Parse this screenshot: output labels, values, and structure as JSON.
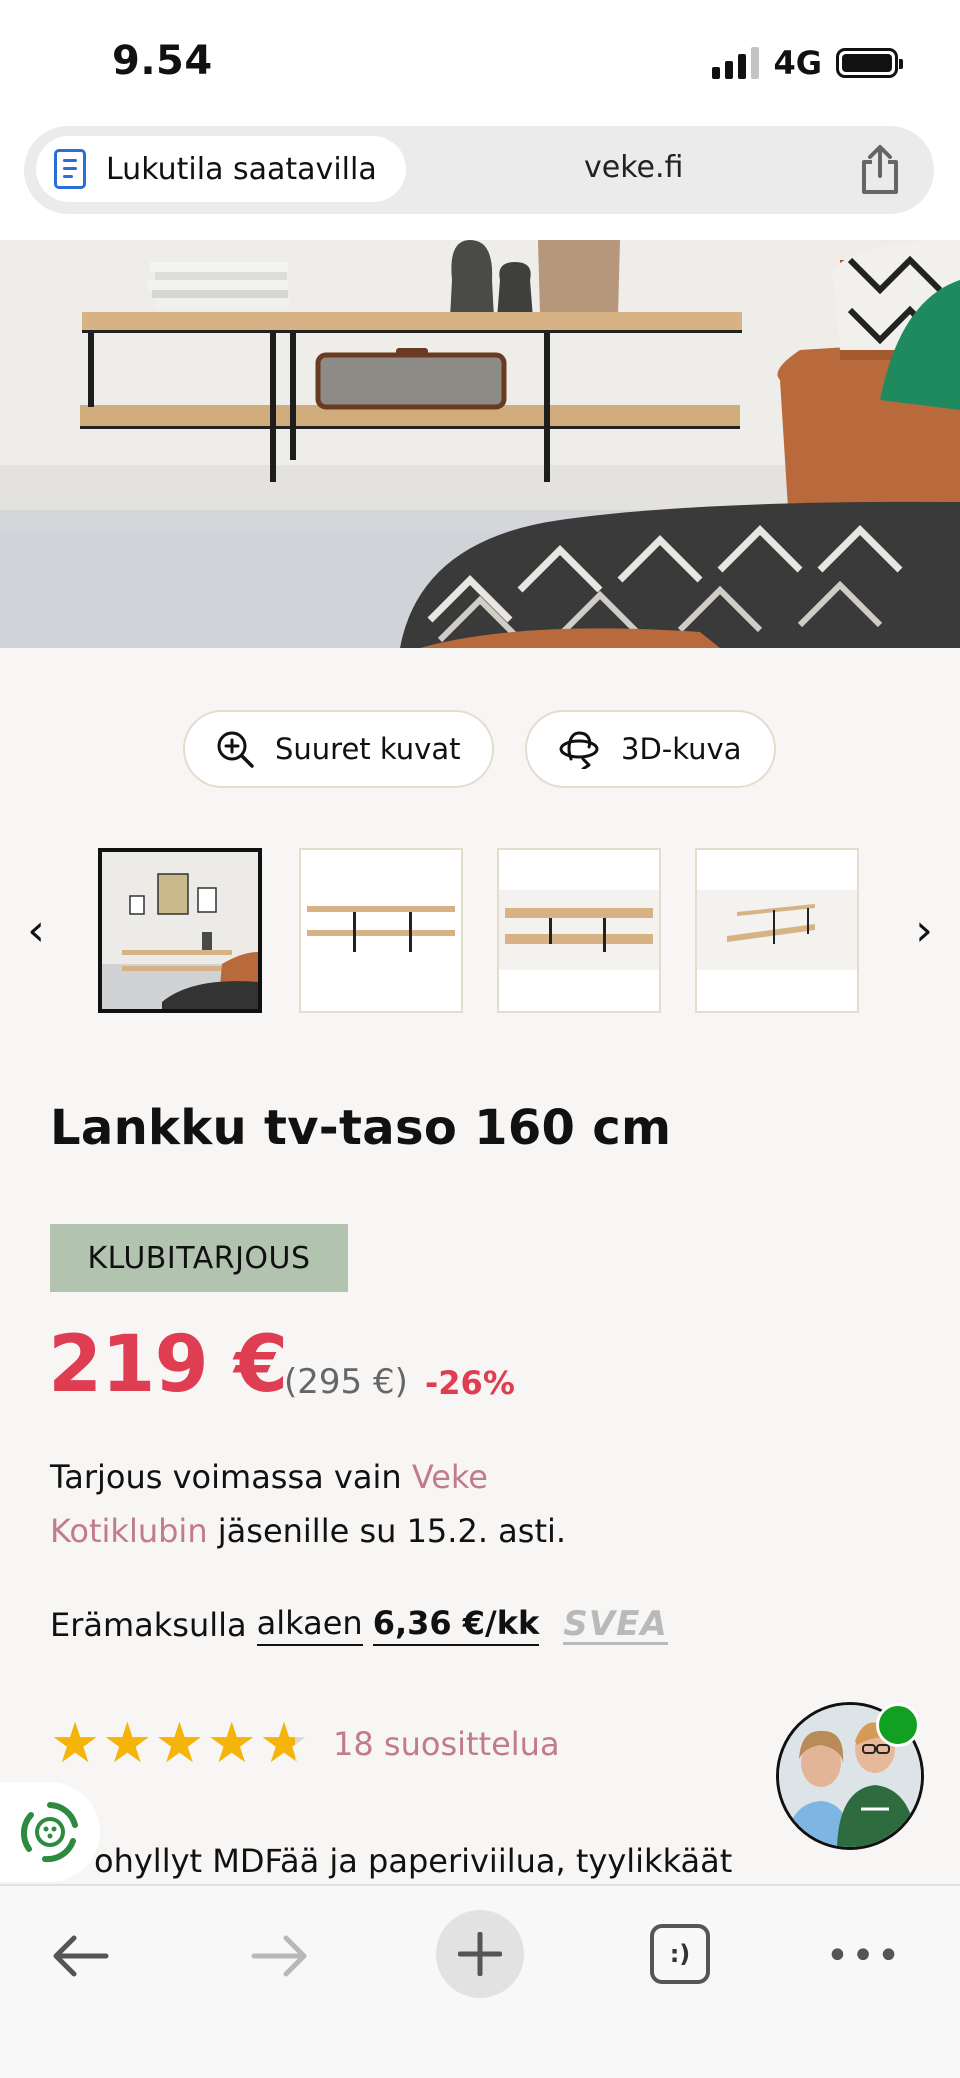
{
  "status_bar": {
    "time": "9.54",
    "network": "4G"
  },
  "browser": {
    "reader_mode_label": "Lukutila saatavilla",
    "domain": "veke.fi"
  },
  "buttons": {
    "large_images": "Suuret kuvat",
    "view_3d": "3D-kuva"
  },
  "gallery": {
    "prev_glyph": "‹",
    "next_glyph": "›",
    "thumbnail_count": 4,
    "active_index": 0
  },
  "product": {
    "title": "Lankku tv-taso 160 cm",
    "badge": "KLUBITARJOUS",
    "price": "219 €",
    "old_price": "(295 €)",
    "discount": "-26%",
    "offer_prefix": "Tarjous voimassa vain ",
    "offer_link": "Veke Kotiklubin",
    "offer_suffix": " jäsenille su 15.2. asti.",
    "installment_prefix": "Erämaksulla",
    "installment_link": "alkaen",
    "installment_amount": "6,36 €/kk",
    "installment_provider": "SVEA",
    "rating": 4.7,
    "rating_max": 5,
    "review_count": "18 suosittelua",
    "description_partial": "ohyllyt MDFää ja paperiviilua, tyylikkäät"
  },
  "toolbar": {
    "tabs_label": ":)",
    "more_label": "•••"
  },
  "colors": {
    "accent_red": "#df3d52",
    "link_pink": "#c27b8c",
    "badge_green": "#b2c4b0",
    "online_green": "#12a022",
    "reader_blue": "#2a6fd6",
    "star_yellow": "#f4b40a"
  }
}
